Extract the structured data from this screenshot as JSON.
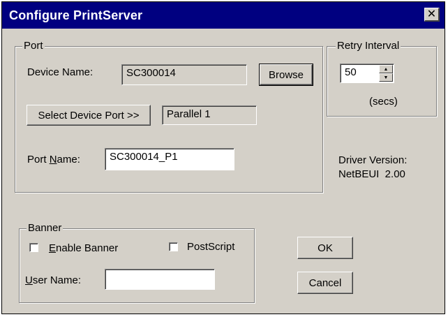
{
  "window": {
    "title": "Configure PrintServer",
    "close_glyph": "✕"
  },
  "port": {
    "group_label": "Port",
    "device_name_label": "Device Name:",
    "device_name_value": "SC300014",
    "browse_label": "Browse",
    "select_port_label": "Select Device Port >>",
    "device_port_value": "Parallel 1",
    "port_name_label_pre": "Port ",
    "port_name_label_ul": "N",
    "port_name_label_post": "ame:",
    "port_name_value": "SC300014_P1"
  },
  "retry": {
    "group_label": "Retry Interval",
    "value": "50",
    "unit": "(secs)"
  },
  "driver": {
    "line1": "Driver Version:",
    "line2": "NetBEUI  2.00"
  },
  "banner": {
    "group_label": "Banner",
    "enable_ul": "E",
    "enable_rest": "nable Banner",
    "enable_checked": false,
    "postscript_label": "PostScript",
    "postscript_checked": false,
    "user_name_ul": "U",
    "user_name_rest": "ser Name:",
    "user_name_value": ""
  },
  "buttons": {
    "ok": "OK",
    "cancel": "Cancel"
  },
  "icons": {
    "close": "close-icon",
    "spin_up": "spin-up-icon",
    "spin_down": "spin-down-icon"
  }
}
